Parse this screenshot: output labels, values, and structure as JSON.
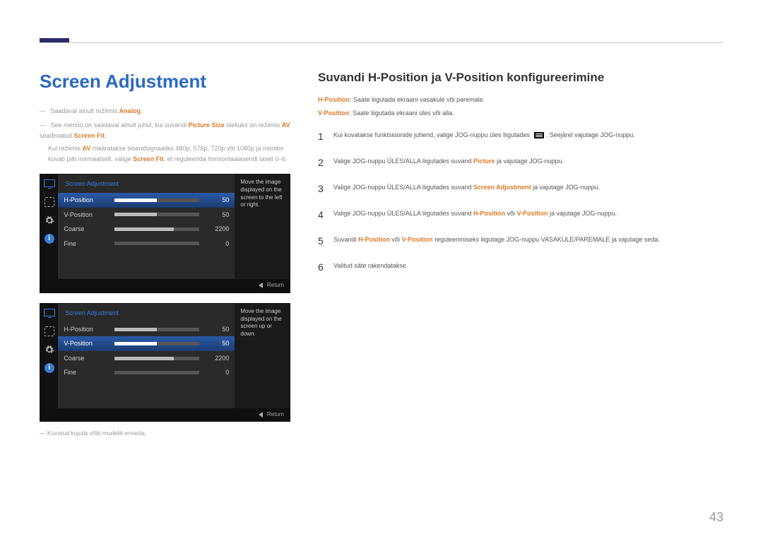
{
  "page": {
    "title": "Screen Adjustment",
    "number": "43"
  },
  "left": {
    "note1_pre": "Saadaval ainult režiimis ",
    "note1_b": "Analog",
    "note1_post": ".",
    "note2_pre": "See menüü on saadaval ainult juhul, kui suvandi ",
    "note2_b1": "Picture Size",
    "note2_mid1": " olekuks on režiimis ",
    "note2_b2": "AV",
    "note2_mid2": " seadistatud ",
    "note2_b3": "Screen Fit",
    "note2_post": ".",
    "note3_pre": "Kui režiimis ",
    "note3_b1": "AV",
    "note3_mid": " määratakse sisendsignaaliks 480p, 576p, 720p või 1080p ja monitor kuvab pilti normaalselt, valige ",
    "note3_b2": "Screen Fit",
    "note3_post": ", et reguleerida horisontaalasendi taset 0–6.",
    "disclaimer": "Kuvatud kujutis võib mudeliti erineda."
  },
  "osd1": {
    "title": "Screen Adjustment",
    "help": "Move the image displayed on the screen to the left or right.",
    "return": "Return",
    "rows": [
      {
        "label": "H-Position",
        "value": "50",
        "pct": 50,
        "selected": true
      },
      {
        "label": "V-Position",
        "value": "50",
        "pct": 50,
        "selected": false
      },
      {
        "label": "Coarse",
        "value": "2200",
        "pct": 70,
        "selected": false
      },
      {
        "label": "Fine",
        "value": "0",
        "pct": 0,
        "selected": false
      }
    ]
  },
  "osd2": {
    "title": "Screen Adjustment",
    "help": "Move the image displayed on the screen up or down.",
    "return": "Return",
    "rows": [
      {
        "label": "H-Position",
        "value": "50",
        "pct": 50,
        "selected": false
      },
      {
        "label": "V-Position",
        "value": "50",
        "pct": 50,
        "selected": true
      },
      {
        "label": "Coarse",
        "value": "2200",
        "pct": 70,
        "selected": false
      },
      {
        "label": "Fine",
        "value": "0",
        "pct": 0,
        "selected": false
      }
    ]
  },
  "right": {
    "subtitle": "Suvandi H-Position ja V-Position konfigureerimine",
    "desc1_b": "H-Position",
    "desc1": ": Saate liigutada ekraani vasakule või paremale.",
    "desc2_b": "V-Position",
    "desc2": ": Saate liigutada ekraani üles või alla.",
    "steps": [
      {
        "n": "1",
        "pre": "Kui kuvatakse funktsioonide juhend, valige JOG-nuppu üles liigutades ",
        "glyph": true,
        "post": ". Seejärel vajutage JOG-nuppu."
      },
      {
        "n": "2",
        "pre": "Valige JOG-nuppu ÜLES/ALLA liigutades suvand ",
        "b": "Picture",
        "post": " ja vajutage JOG-nuppu."
      },
      {
        "n": "3",
        "pre": "Valige JOG-nuppu ÜLES/ALLA liigutades suvand ",
        "b": "Screen Adjustment",
        "post": " ja vajutage JOG-nuppu."
      },
      {
        "n": "4",
        "pre": "Valige JOG-nuppu ÜLES/ALLA liigutades suvand ",
        "b": "H-Position",
        "mid": " või ",
        "b2": "V-Position",
        "post": " ja vajutage JOG-nuppu."
      },
      {
        "n": "5",
        "pre": "Suvandi ",
        "b": "H-Position",
        "mid": " või ",
        "b2": "V-Position",
        "post": " reguleerimiseks liigutage JOG-nuppu VASAKULE/PAREMALE ja vajutage seda."
      },
      {
        "n": "6",
        "pre": "Valitud säte rakendatakse."
      }
    ]
  }
}
